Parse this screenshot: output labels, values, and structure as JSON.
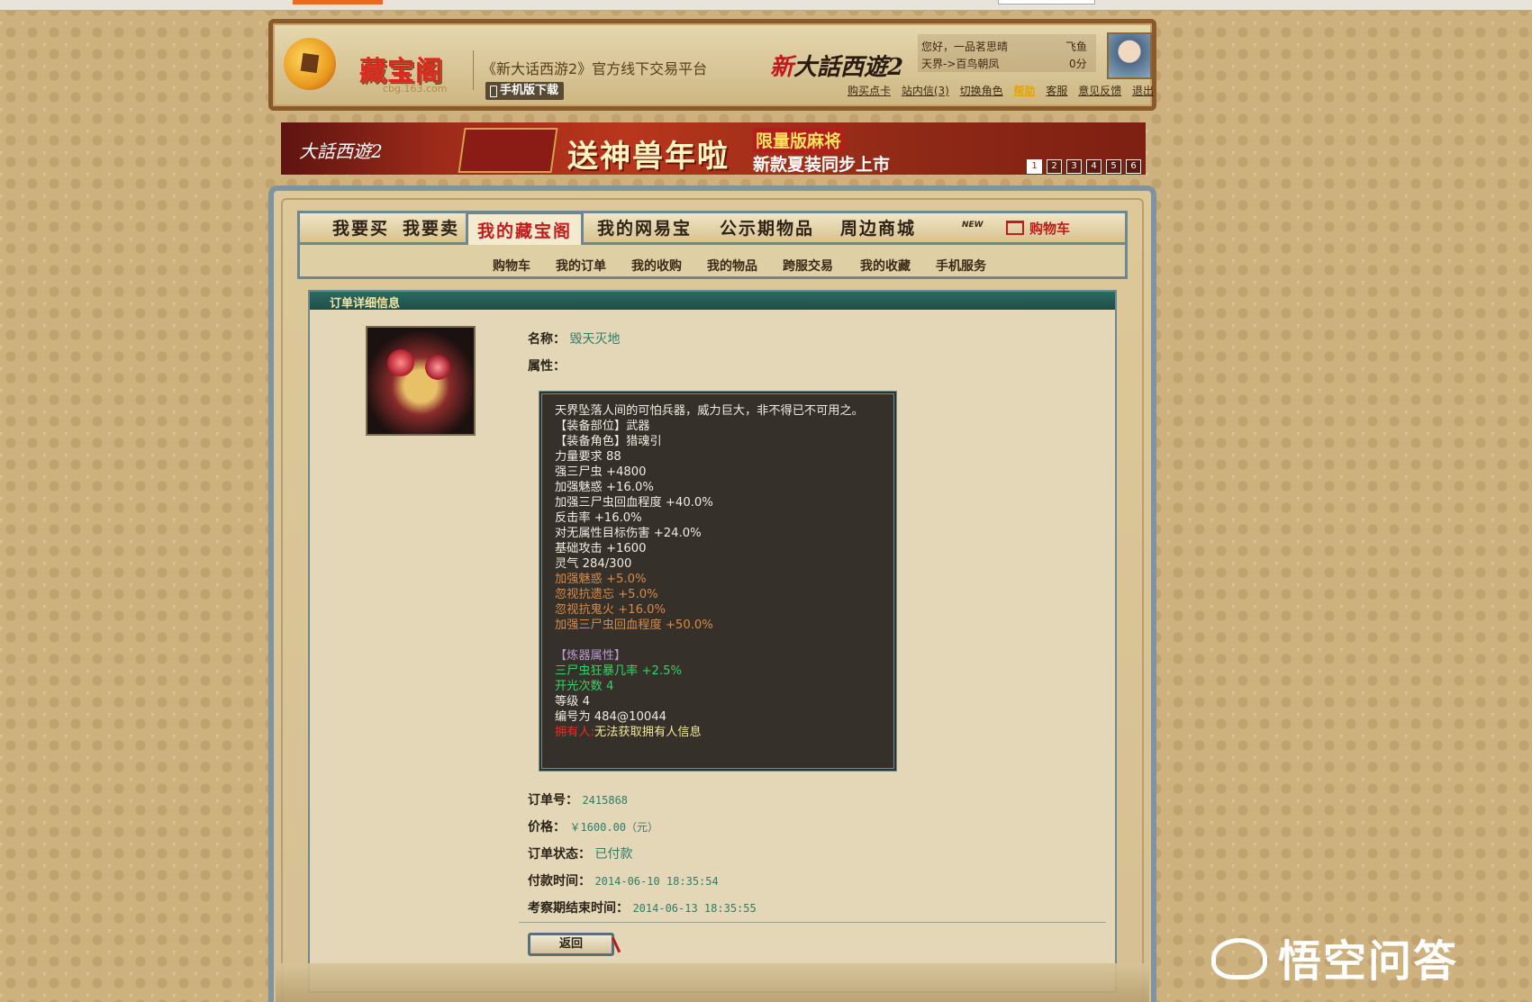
{
  "header": {
    "logo_text": "藏宝阁",
    "logo_sub": "cbg.163.com",
    "platform": "《新大话西游2》官方线下交易平台",
    "mobile_download": "手机版下载",
    "game_logo_red": "新",
    "game_logo_rest": "大話西遊2",
    "greeting": "您好，",
    "user_name": "一品茗思晴",
    "user_tag": "飞鱼",
    "server": "天界->百鸟朝凤",
    "points": "0分",
    "links": [
      "购买点卡",
      "站内信(3)",
      "切换角色",
      "帮助",
      "客服",
      "意见反馈",
      "退出"
    ]
  },
  "banner": {
    "game": "大話西遊2",
    "headline": "送神兽年啦",
    "sub1": "限量版麻将",
    "sub2": "新款夏装同步上市",
    "pages": [
      "1",
      "2",
      "3",
      "4",
      "5",
      "6"
    ],
    "active_page": "1"
  },
  "nav": {
    "items": [
      "我要买",
      "我要卖",
      "我的藏宝阁",
      "我的网易宝",
      "公示期物品",
      "周边商城"
    ],
    "active": "我的藏宝阁",
    "new_badge": "NEW",
    "cart": "购物车",
    "sub_items": [
      "购物车",
      "我的订单",
      "我的收购",
      "我的物品",
      "跨服交易",
      "我的收藏",
      "手机服务"
    ]
  },
  "order": {
    "section_title": "订单详细信息",
    "name_label": "名称：",
    "name_value": "毁天灭地",
    "attr_label": "属性：",
    "description_lines": [
      {
        "text": "天界坠落人间的可怕兵器，威力巨大，非不得已不可用之。",
        "color": "white"
      },
      {
        "text": "【装备部位】武器",
        "color": "white"
      },
      {
        "text": "【装备角色】猎魂引",
        "color": "white"
      },
      {
        "text": "力量要求 88",
        "color": "white"
      },
      {
        "text": "强三尸虫 +4800",
        "color": "white"
      },
      {
        "text": "加强魅惑 +16.0%",
        "color": "white"
      },
      {
        "text": "加强三尸虫回血程度 +40.0%",
        "color": "white"
      },
      {
        "text": "反击率 +16.0%",
        "color": "white"
      },
      {
        "text": "对无属性目标伤害 +24.0%",
        "color": "white"
      },
      {
        "text": "基础攻击 +1600",
        "color": "white"
      },
      {
        "text": "灵气 284/300",
        "color": "white"
      },
      {
        "text": "加强魅惑 +5.0%",
        "color": "orange"
      },
      {
        "text": "忽视抗遗忘 +5.0%",
        "color": "orange"
      },
      {
        "text": "忽视抗鬼火 +16.0%",
        "color": "orange"
      },
      {
        "text": "加强三尸虫回血程度 +50.0%",
        "color": "orange"
      },
      {
        "text": "",
        "color": "white"
      },
      {
        "text": "【炼器属性】",
        "color": "purple"
      },
      {
        "text": "三尸虫狂暴几率 +2.5%",
        "color": "green"
      },
      {
        "text": "开光次数 4",
        "color": "green"
      },
      {
        "text": "等级 4",
        "color": "white"
      },
      {
        "text": "编号为 484@10044",
        "color": "white"
      }
    ],
    "owner_label": "拥有人:",
    "owner_value": "无法获取拥有人信息",
    "order_no_label": "订单号：",
    "order_no": "2415868",
    "price_label": "价格：",
    "price": "￥1600.00（元）",
    "status_label": "订单状态：",
    "status": "已付款",
    "paid_time_label": "付款时间：",
    "paid_time": "2014-06-10 18:35:54",
    "review_end_label": "考察期结束时间：",
    "review_end": "2014-06-13 18:35:55",
    "back_button": "返回"
  },
  "watermark": "悟空问答",
  "colors": {
    "accent_red": "#c41b1b",
    "teal_title": "#1d4e48",
    "value_green": "#2f7c6a"
  }
}
